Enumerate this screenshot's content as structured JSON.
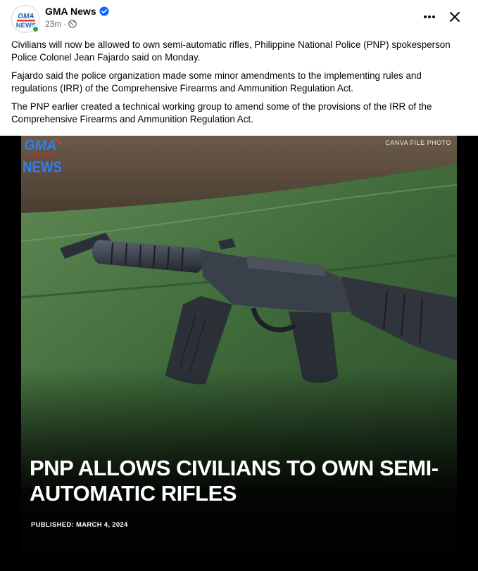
{
  "post": {
    "page_name": "GMA News",
    "time": "23m",
    "separator": "·",
    "paragraphs": [
      "Civilians will now be allowed to own semi-automatic rifles, Philippine National Police (PNP) spokesperson Police Colonel Jean Fajardo said on Monday.",
      "Fajardo said the police organization made some minor amendments to the implementing rules and regulations (IRR) of the Comprehensive Firearms and Ammunition Regulation Act.",
      "The PNP earlier created a technical working group to amend some of the provisions of the IRR of the Comprehensive Firearms and Ammunition Regulation Act."
    ]
  },
  "image": {
    "credit": "CANVA FILE PHOTO",
    "headline": "PNP ALLOWS CIVILIANS TO OWN SEMI-AUTOMATIC RIFLES",
    "published": "PUBLISHED: MARCH 4, 2024",
    "logo_text_top": "GMA",
    "logo_text_mid": "INTEGRATED",
    "logo_text_bottom": "NEWS"
  },
  "icons": {
    "verified": "verified-badge-icon",
    "privacy": "globe-icon",
    "more": "more-options-icon",
    "close": "close-icon"
  },
  "colors": {
    "verified_blue": "#0866ff",
    "online_green": "#31a24c",
    "meta_gray": "#65676b",
    "logo_blue": "#1a5fb4"
  }
}
